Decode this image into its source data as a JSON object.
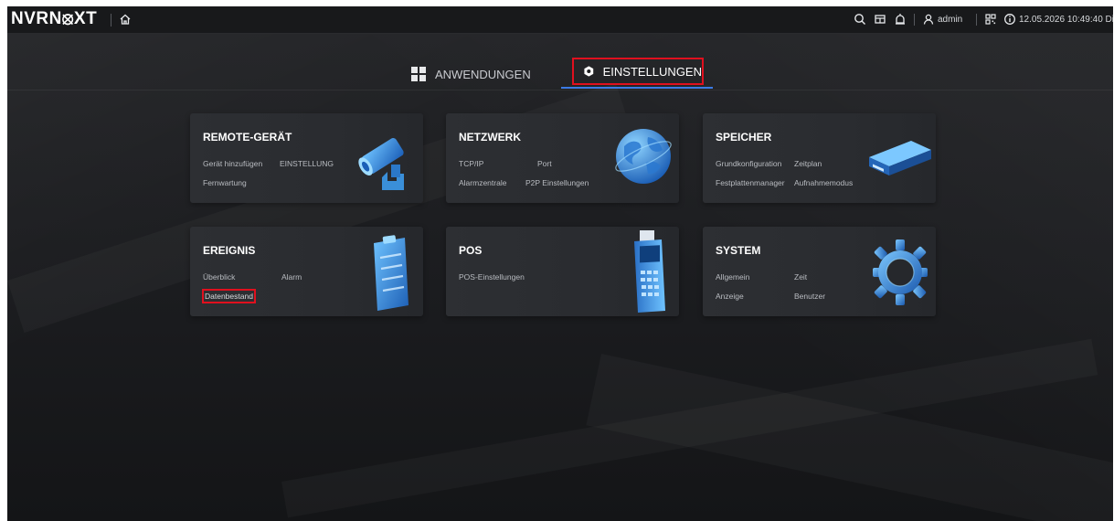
{
  "topbar": {
    "logo": "NVRN⦻XT",
    "user": "admin",
    "datetime": "12.05.2026 10:49:40 Di",
    "icons": [
      "home-icon",
      "search-icon",
      "layout-icon",
      "alarm-icon",
      "user-icon",
      "qr-icon",
      "info-icon"
    ]
  },
  "tabs": {
    "apps_label": "ANWENDUNGEN",
    "settings_label": "EINSTELLUNGEN",
    "active": "settings"
  },
  "cards": {
    "remote": {
      "title": "REMOTE-GERÄT",
      "links": [
        "Gerät hinzufügen",
        "EINSTELLUNG",
        "Fernwartung"
      ]
    },
    "network": {
      "title": "NETZWERK",
      "links": [
        "TCP/IP",
        "Port",
        "Alarmzentrale",
        "P2P Einstellungen"
      ]
    },
    "storage": {
      "title": "SPEICHER",
      "links": [
        "Grundkonfiguration",
        "Zeitplan",
        "Festplattenmanager",
        "Aufnahmemodus"
      ]
    },
    "event": {
      "title": "EREIGNIS",
      "links": [
        "Überblick",
        "Alarm",
        "Datenbestand"
      ]
    },
    "pos": {
      "title": "POS",
      "links": [
        "POS-Einstellungen"
      ]
    },
    "system": {
      "title": "SYSTEM",
      "links": [
        "Allgemein",
        "Zeit",
        "Anzeige",
        "Benutzer"
      ]
    }
  },
  "colors": {
    "accent_blue": "#3b7be6",
    "highlight_red": "#e0101e",
    "card_bg": "#2d2f33",
    "icon_blue": "#3a8fd9"
  }
}
